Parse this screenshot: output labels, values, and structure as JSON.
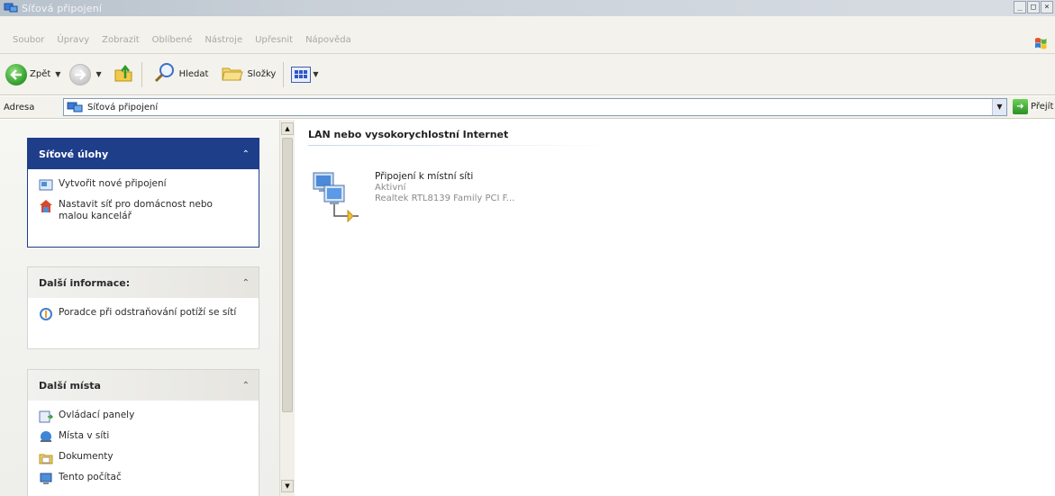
{
  "window": {
    "title": "Síťová připojení",
    "controls": [
      "_",
      "□",
      "×"
    ]
  },
  "menu": [
    "Soubor",
    "Úpravy",
    "Zobrazit",
    "Oblíbené",
    "Nástroje",
    "Upřesnit",
    "Nápověda"
  ],
  "toolbar": {
    "back_label": "Zpět",
    "search_label": "Hledat",
    "folders_label": "Složky"
  },
  "address": {
    "label": "Adresa",
    "value": "Síťová připojení",
    "go_label": "Přejít"
  },
  "panels": {
    "network_tasks": {
      "title": "Síťové úlohy",
      "items": [
        {
          "label": "Vytvořit nové připojení",
          "icon": "new-connection-icon"
        },
        {
          "label": "Nastavit síť pro domácnost nebo malou kancelář",
          "icon": "home-network-icon"
        }
      ]
    },
    "more_info": {
      "title": "Další informace:",
      "items": [
        {
          "label": "Poradce při odstraňování potíží se sítí",
          "icon": "troubleshooter-icon"
        }
      ]
    },
    "other_places": {
      "title": "Další místa",
      "items": [
        {
          "label": "Ovládací panely",
          "icon": "control-panel-icon"
        },
        {
          "label": "Místa v síti",
          "icon": "network-places-icon"
        },
        {
          "label": "Dokumenty",
          "icon": "documents-icon"
        },
        {
          "label": "Tento počítač",
          "icon": "my-computer-icon"
        }
      ]
    }
  },
  "content": {
    "group_title": "LAN nebo vysokorychlostní Internet",
    "connection": {
      "name": "Připojení k místní síti",
      "status": "Aktivní",
      "device": "Realtek RTL8139 Family PCI F..."
    }
  },
  "colors": {
    "task_header_dark": "#1f3e8a",
    "address_border": "#7f9db9",
    "go_green": "#2a8f24"
  }
}
